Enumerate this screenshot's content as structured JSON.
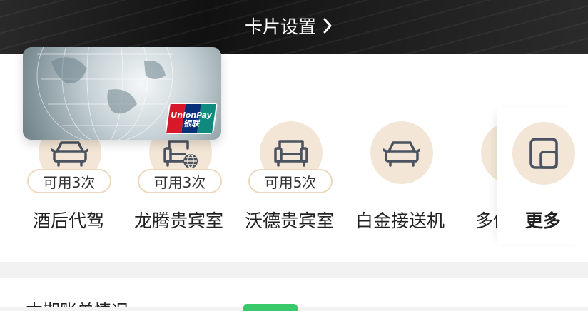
{
  "header": {
    "card_settings_label": "卡片设置",
    "chevron_icon": "chevron-right-icon"
  },
  "card": {
    "brand_icon": "unionpay-logo",
    "brand_text": "UnionPay 银联"
  },
  "benefits": [
    {
      "name": "酒后代驾",
      "badge": "可用3次",
      "icon": "car-icon"
    },
    {
      "name": "龙腾贵宾室",
      "badge": "可用3次",
      "icon": "lounge-globe-icon"
    },
    {
      "name": "沃德贵宾室",
      "badge": "可用5次",
      "icon": "sofa-icon"
    },
    {
      "name": "白金接送机",
      "badge": "",
      "icon": "car-icon"
    },
    {
      "name": "多倍",
      "badge": "",
      "icon": "partial-icon"
    }
  ],
  "more": {
    "label": "更多",
    "icon": "more-grid-icon"
  },
  "bottom": {
    "partial_text": "本期账单情况",
    "pill_color": "#39c86a"
  },
  "colors": {
    "accent_circle": "#f3e6d6",
    "badge_border": "#edd8bd",
    "icon_stroke": "#4a5360"
  }
}
